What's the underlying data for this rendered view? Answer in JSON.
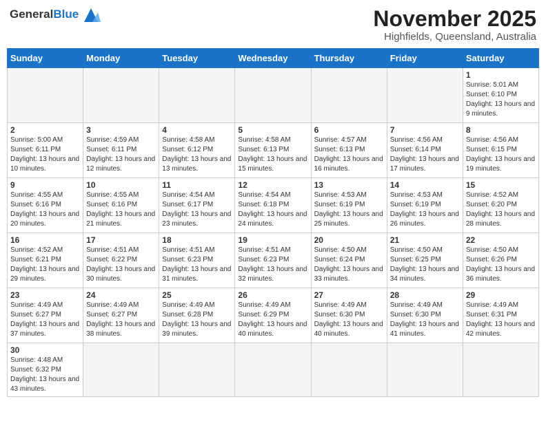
{
  "header": {
    "logo_general": "General",
    "logo_blue": "Blue",
    "month_title": "November 2025",
    "location": "Highfields, Queensland, Australia"
  },
  "days_of_week": [
    "Sunday",
    "Monday",
    "Tuesday",
    "Wednesday",
    "Thursday",
    "Friday",
    "Saturday"
  ],
  "weeks": [
    [
      {
        "day": "",
        "info": ""
      },
      {
        "day": "",
        "info": ""
      },
      {
        "day": "",
        "info": ""
      },
      {
        "day": "",
        "info": ""
      },
      {
        "day": "",
        "info": ""
      },
      {
        "day": "",
        "info": ""
      },
      {
        "day": "1",
        "info": "Sunrise: 5:01 AM\nSunset: 6:10 PM\nDaylight: 13 hours\nand 9 minutes."
      }
    ],
    [
      {
        "day": "2",
        "info": "Sunrise: 5:00 AM\nSunset: 6:11 PM\nDaylight: 13 hours\nand 10 minutes."
      },
      {
        "day": "3",
        "info": "Sunrise: 4:59 AM\nSunset: 6:11 PM\nDaylight: 13 hours\nand 12 minutes."
      },
      {
        "day": "4",
        "info": "Sunrise: 4:58 AM\nSunset: 6:12 PM\nDaylight: 13 hours\nand 13 minutes."
      },
      {
        "day": "5",
        "info": "Sunrise: 4:58 AM\nSunset: 6:13 PM\nDaylight: 13 hours\nand 15 minutes."
      },
      {
        "day": "6",
        "info": "Sunrise: 4:57 AM\nSunset: 6:13 PM\nDaylight: 13 hours\nand 16 minutes."
      },
      {
        "day": "7",
        "info": "Sunrise: 4:56 AM\nSunset: 6:14 PM\nDaylight: 13 hours\nand 17 minutes."
      },
      {
        "day": "8",
        "info": "Sunrise: 4:56 AM\nSunset: 6:15 PM\nDaylight: 13 hours\nand 19 minutes."
      }
    ],
    [
      {
        "day": "9",
        "info": "Sunrise: 4:55 AM\nSunset: 6:16 PM\nDaylight: 13 hours\nand 20 minutes."
      },
      {
        "day": "10",
        "info": "Sunrise: 4:55 AM\nSunset: 6:16 PM\nDaylight: 13 hours\nand 21 minutes."
      },
      {
        "day": "11",
        "info": "Sunrise: 4:54 AM\nSunset: 6:17 PM\nDaylight: 13 hours\nand 23 minutes."
      },
      {
        "day": "12",
        "info": "Sunrise: 4:54 AM\nSunset: 6:18 PM\nDaylight: 13 hours\nand 24 minutes."
      },
      {
        "day": "13",
        "info": "Sunrise: 4:53 AM\nSunset: 6:19 PM\nDaylight: 13 hours\nand 25 minutes."
      },
      {
        "day": "14",
        "info": "Sunrise: 4:53 AM\nSunset: 6:19 PM\nDaylight: 13 hours\nand 26 minutes."
      },
      {
        "day": "15",
        "info": "Sunrise: 4:52 AM\nSunset: 6:20 PM\nDaylight: 13 hours\nand 28 minutes."
      }
    ],
    [
      {
        "day": "16",
        "info": "Sunrise: 4:52 AM\nSunset: 6:21 PM\nDaylight: 13 hours\nand 29 minutes."
      },
      {
        "day": "17",
        "info": "Sunrise: 4:51 AM\nSunset: 6:22 PM\nDaylight: 13 hours\nand 30 minutes."
      },
      {
        "day": "18",
        "info": "Sunrise: 4:51 AM\nSunset: 6:23 PM\nDaylight: 13 hours\nand 31 minutes."
      },
      {
        "day": "19",
        "info": "Sunrise: 4:51 AM\nSunset: 6:23 PM\nDaylight: 13 hours\nand 32 minutes."
      },
      {
        "day": "20",
        "info": "Sunrise: 4:50 AM\nSunset: 6:24 PM\nDaylight: 13 hours\nand 33 minutes."
      },
      {
        "day": "21",
        "info": "Sunrise: 4:50 AM\nSunset: 6:25 PM\nDaylight: 13 hours\nand 34 minutes."
      },
      {
        "day": "22",
        "info": "Sunrise: 4:50 AM\nSunset: 6:26 PM\nDaylight: 13 hours\nand 36 minutes."
      }
    ],
    [
      {
        "day": "23",
        "info": "Sunrise: 4:49 AM\nSunset: 6:27 PM\nDaylight: 13 hours\nand 37 minutes."
      },
      {
        "day": "24",
        "info": "Sunrise: 4:49 AM\nSunset: 6:27 PM\nDaylight: 13 hours\nand 38 minutes."
      },
      {
        "day": "25",
        "info": "Sunrise: 4:49 AM\nSunset: 6:28 PM\nDaylight: 13 hours\nand 39 minutes."
      },
      {
        "day": "26",
        "info": "Sunrise: 4:49 AM\nSunset: 6:29 PM\nDaylight: 13 hours\nand 40 minutes."
      },
      {
        "day": "27",
        "info": "Sunrise: 4:49 AM\nSunset: 6:30 PM\nDaylight: 13 hours\nand 40 minutes."
      },
      {
        "day": "28",
        "info": "Sunrise: 4:49 AM\nSunset: 6:30 PM\nDaylight: 13 hours\nand 41 minutes."
      },
      {
        "day": "29",
        "info": "Sunrise: 4:49 AM\nSunset: 6:31 PM\nDaylight: 13 hours\nand 42 minutes."
      }
    ],
    [
      {
        "day": "30",
        "info": "Sunrise: 4:48 AM\nSunset: 6:32 PM\nDaylight: 13 hours\nand 43 minutes."
      },
      {
        "day": "",
        "info": ""
      },
      {
        "day": "",
        "info": ""
      },
      {
        "day": "",
        "info": ""
      },
      {
        "day": "",
        "info": ""
      },
      {
        "day": "",
        "info": ""
      },
      {
        "day": "",
        "info": ""
      }
    ]
  ]
}
